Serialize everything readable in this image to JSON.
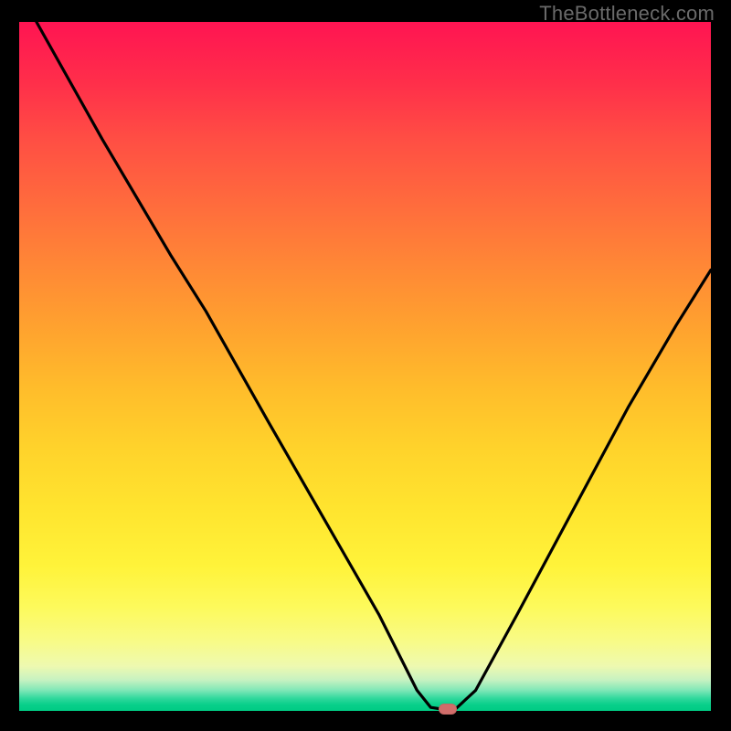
{
  "watermark": "TheBottleneck.com",
  "chart_data": {
    "type": "line",
    "title": "",
    "xlabel": "",
    "ylabel": "",
    "xlim": [
      0,
      100
    ],
    "ylim": [
      0,
      100
    ],
    "grid": false,
    "legend": false,
    "series": [
      {
        "name": "curve",
        "x": [
          2.5,
          12,
          22,
          27,
          36,
          44,
          52,
          57.5,
          59.5,
          61.5,
          63,
          66,
          72,
          80,
          88,
          95,
          100
        ],
        "values": [
          100,
          83,
          66,
          58,
          42,
          28,
          14,
          3,
          0.5,
          0.2,
          0.2,
          3,
          14,
          29,
          44,
          56,
          64
        ]
      }
    ],
    "marker": {
      "x": 62,
      "y": 0.3
    },
    "colors": {
      "curve": "#000000",
      "marker": "#d16d6a",
      "gradient_top": "#ff1452",
      "gradient_bottom": "#00cb84"
    }
  }
}
